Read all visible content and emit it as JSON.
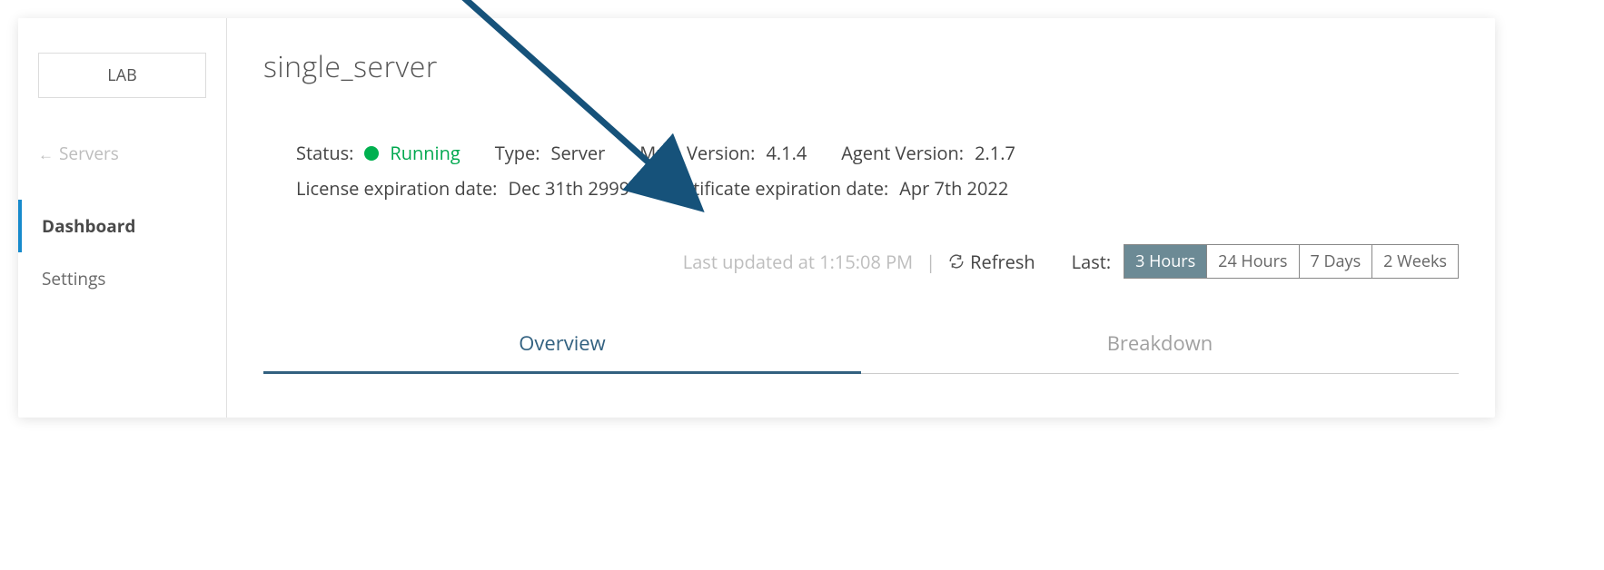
{
  "sidebar": {
    "env_label": "LAB",
    "back_label": "Servers",
    "nav": {
      "dashboard": "Dashboard",
      "settings": "Settings"
    }
  },
  "header": {
    "title": "single_server"
  },
  "details": {
    "status_label": "Status:",
    "status_value": "Running",
    "type_label": "Type:",
    "type_value": "Server",
    "mule_version_label": "Mule Version:",
    "mule_version_value": "4.1.4",
    "agent_version_label": "Agent Version:",
    "agent_version_value": "2.1.7",
    "license_exp_label": "License expiration date:",
    "license_exp_value": "Dec 31th 2999",
    "cert_exp_label": "Certificate expiration date:",
    "cert_exp_value": "Apr 7th 2022"
  },
  "refresh": {
    "last_updated": "Last updated at 1:15:08 PM",
    "refresh_label": "Refresh",
    "last_label": "Last:",
    "ranges": {
      "r0": "3 Hours",
      "r1": "24 Hours",
      "r2": "7 Days",
      "r3": "2 Weeks"
    }
  },
  "tabs": {
    "overview": "Overview",
    "breakdown": "Breakdown"
  },
  "colors": {
    "status_dot": "#00b04f",
    "accent_tab": "#326180",
    "range_active_bg": "#6c8a95",
    "sidebar_active_border": "#178acc",
    "arrow": "#16527a"
  }
}
